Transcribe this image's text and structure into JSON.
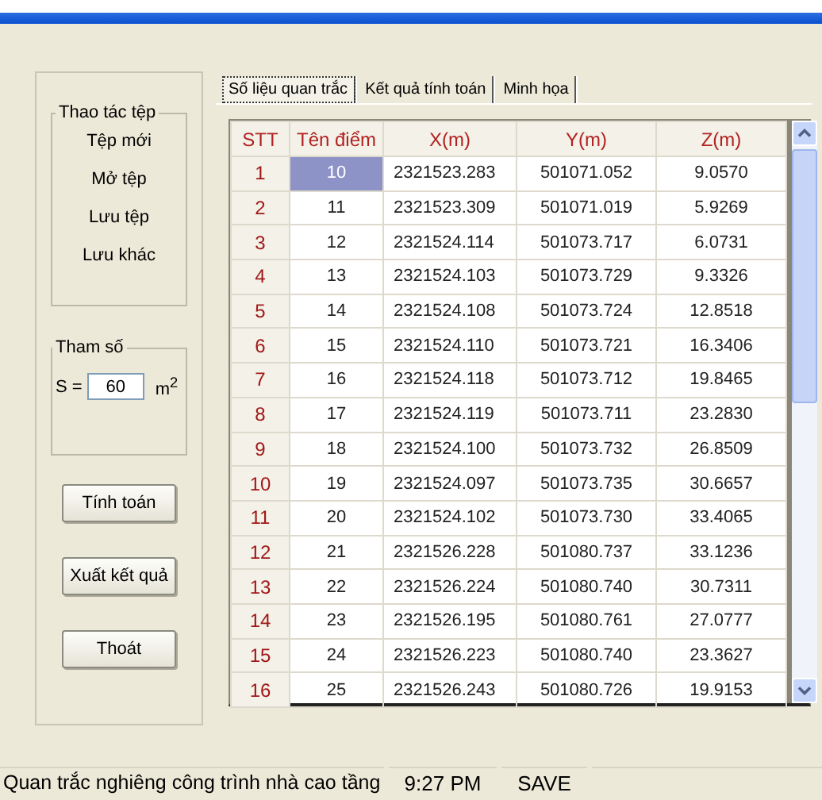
{
  "file_group": {
    "title": "Thao tác tệp",
    "items": [
      "Tệp mới",
      "Mở tệp",
      "Lưu tệp",
      "Lưu khác"
    ]
  },
  "params": {
    "title": "Tham số",
    "label": "S =",
    "value": "60",
    "unit": "m",
    "unit_power": "2"
  },
  "buttons": [
    "Tính toán",
    "Xuất kết quả",
    "Thoát"
  ],
  "tabs": [
    {
      "label": "Số liệu quan trắc",
      "selected": true
    },
    {
      "label": "Kết quả tính toán",
      "selected": false
    },
    {
      "label": "Minh họa",
      "selected": false
    }
  ],
  "table": {
    "columns": [
      "STT",
      "Tên điểm",
      "X(m)",
      "Y(m)",
      "Z(m)"
    ],
    "rows": [
      {
        "cells": [
          "1",
          "10",
          "2321523.283",
          "501071.052",
          "9.0570"
        ],
        "selected": true
      },
      {
        "cells": [
          "2",
          "11",
          "2321523.309",
          "501071.019",
          "5.9269"
        ],
        "selected": false
      },
      {
        "cells": [
          "3",
          "12",
          "2321524.114",
          "501073.717",
          "6.0731"
        ],
        "selected": false
      },
      {
        "cells": [
          "4",
          "13",
          "2321524.103",
          "501073.729",
          "9.3326"
        ],
        "selected": false
      },
      {
        "cells": [
          "5",
          "14",
          "2321524.108",
          "501073.724",
          "12.8518"
        ],
        "selected": false
      },
      {
        "cells": [
          "6",
          "15",
          "2321524.110",
          "501073.721",
          "16.3406"
        ],
        "selected": false
      },
      {
        "cells": [
          "7",
          "16",
          "2321524.118",
          "501073.712",
          "19.8465"
        ],
        "selected": false
      },
      {
        "cells": [
          "8",
          "17",
          "2321524.119",
          "501073.711",
          "23.2830"
        ],
        "selected": false
      },
      {
        "cells": [
          "9",
          "18",
          "2321524.100",
          "501073.732",
          "26.8509"
        ],
        "selected": false
      },
      {
        "cells": [
          "10",
          "19",
          "2321524.097",
          "501073.735",
          "30.6657"
        ],
        "selected": false
      },
      {
        "cells": [
          "11",
          "20",
          "2321524.102",
          "501073.730",
          "33.4065"
        ],
        "selected": false
      },
      {
        "cells": [
          "12",
          "21",
          "2321526.228",
          "501080.737",
          "33.1236"
        ],
        "selected": false
      },
      {
        "cells": [
          "13",
          "22",
          "2321526.224",
          "501080.740",
          "30.7311"
        ],
        "selected": false
      },
      {
        "cells": [
          "14",
          "23",
          "2321526.195",
          "501080.761",
          "27.0777"
        ],
        "selected": false
      },
      {
        "cells": [
          "15",
          "24",
          "2321526.223",
          "501080.740",
          "23.3627"
        ],
        "selected": false
      },
      {
        "cells": [
          "16",
          "25",
          "2321526.243",
          "501080.726",
          "19.9153"
        ],
        "selected": false
      }
    ]
  },
  "status_bar": [
    "Quan trắc nghiêng công trình nhà cao tầng",
    "9:27 PM",
    "SAVE"
  ]
}
